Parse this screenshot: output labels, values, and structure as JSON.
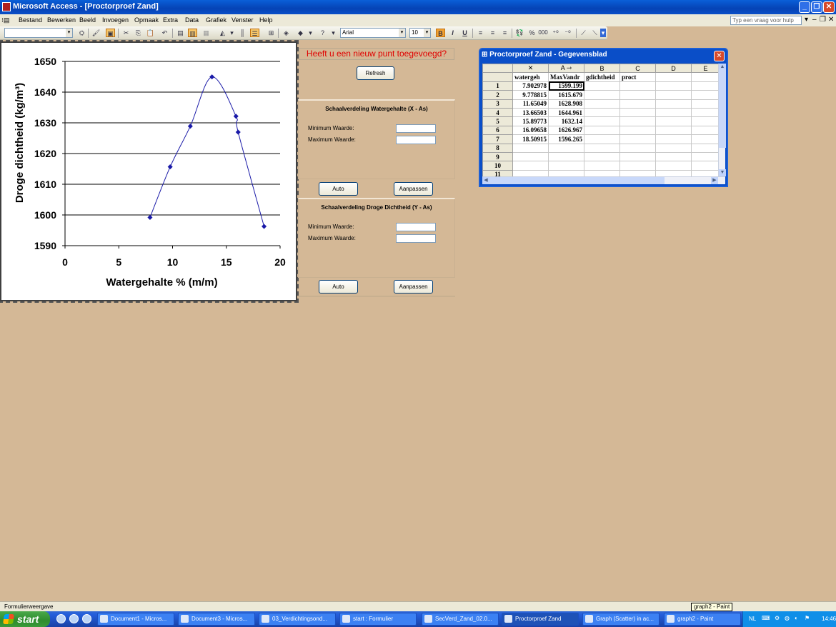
{
  "window": {
    "title": "Microsoft Access - [Proctorproef Zand]",
    "min": "_",
    "restore": "❐",
    "close": "✕"
  },
  "menu": {
    "items": [
      "Bestand",
      "Bewerken",
      "Beeld",
      "Invoegen",
      "Opmaak",
      "Extra",
      "Data",
      "Grafiek",
      "Venster",
      "Help"
    ],
    "help_placeholder": "Typ een vraag voor hulp"
  },
  "toolbar": {
    "font": "Arial",
    "size": "10",
    "bold": "B",
    "italic": "I",
    "underline": "U",
    "percent": "%",
    "thousands": "000"
  },
  "chart_data": {
    "type": "scatter",
    "title": "",
    "xlabel": "Watergehalte % (m/m)",
    "ylabel": "Droge dichtheid (kg/m³)",
    "xlim": [
      0,
      20
    ],
    "ylim": [
      1590,
      1650
    ],
    "x_ticks": [
      0,
      5,
      10,
      15,
      20
    ],
    "y_ticks": [
      1590,
      1600,
      1610,
      1620,
      1630,
      1640,
      1650
    ],
    "grid": "horizontal",
    "points": [
      {
        "x": 7.902978,
        "y": 1599.199
      },
      {
        "x": 9.778815,
        "y": 1615.679
      },
      {
        "x": 11.65049,
        "y": 1628.908
      },
      {
        "x": 13.66503,
        "y": 1644.961
      },
      {
        "x": 15.89773,
        "y": 1632.14
      },
      {
        "x": 16.09658,
        "y": 1626.967
      },
      {
        "x": 18.50915,
        "y": 1596.265
      }
    ],
    "line_color": "#1a1aa8"
  },
  "form": {
    "notice": "Heeft u een nieuw punt toegevoegd?",
    "refresh": "Refresh",
    "x_section": {
      "title": "Schaalverdeling Watergehalte (X - As)",
      "min_label": "Minimum Waarde:",
      "max_label": "Maximum Waarde:",
      "min_value": "",
      "max_value": "",
      "auto": "Auto",
      "apply": "Aanpassen"
    },
    "y_section": {
      "title": "Schaalverdeling Droge Dichtheid (Y - As)",
      "min_label": "Minimum Waarde:",
      "max_label": "Maximum Waarde:",
      "min_value": "",
      "max_value": "",
      "auto": "Auto",
      "apply": "Aanpassen"
    }
  },
  "datasheet": {
    "title": "Proctorproef Zand - Gegevensblad",
    "columns": [
      "",
      "A",
      "B",
      "C",
      "D",
      "E"
    ],
    "header_row": [
      "watergeh",
      "MaxVandr",
      "gdichtheid",
      "proct",
      "",
      ""
    ],
    "rows": [
      {
        "n": "1",
        "a": "7.902978",
        "b": "1599.199"
      },
      {
        "n": "2",
        "a": "9.778815",
        "b": "1615.679"
      },
      {
        "n": "3",
        "a": "11.65049",
        "b": "1628.908"
      },
      {
        "n": "4",
        "a": "13.66503",
        "b": "1644.961"
      },
      {
        "n": "5",
        "a": "15.89773",
        "b": "1632.14"
      },
      {
        "n": "6",
        "a": "16.09658",
        "b": "1626.967"
      },
      {
        "n": "7",
        "a": "18.50915",
        "b": "1596.265"
      },
      {
        "n": "8",
        "a": "",
        "b": ""
      },
      {
        "n": "9",
        "a": "",
        "b": ""
      },
      {
        "n": "10",
        "a": "",
        "b": ""
      },
      {
        "n": "11",
        "a": "",
        "b": ""
      }
    ]
  },
  "status": {
    "text": "Formulierweergave",
    "tooltip": "graph2 - Paint"
  },
  "taskbar": {
    "start": "start",
    "tasks": [
      "Document1 - Micros...",
      "Document3 - Micros...",
      "03_Verdichtingsond...",
      "start : Formulier",
      "SecVerd_Zand_02.0...",
      "Proctorproef Zand",
      "Graph (Scatter) in ac...",
      "graph2 - Paint"
    ],
    "lang": "NL",
    "clock": "14:46"
  }
}
